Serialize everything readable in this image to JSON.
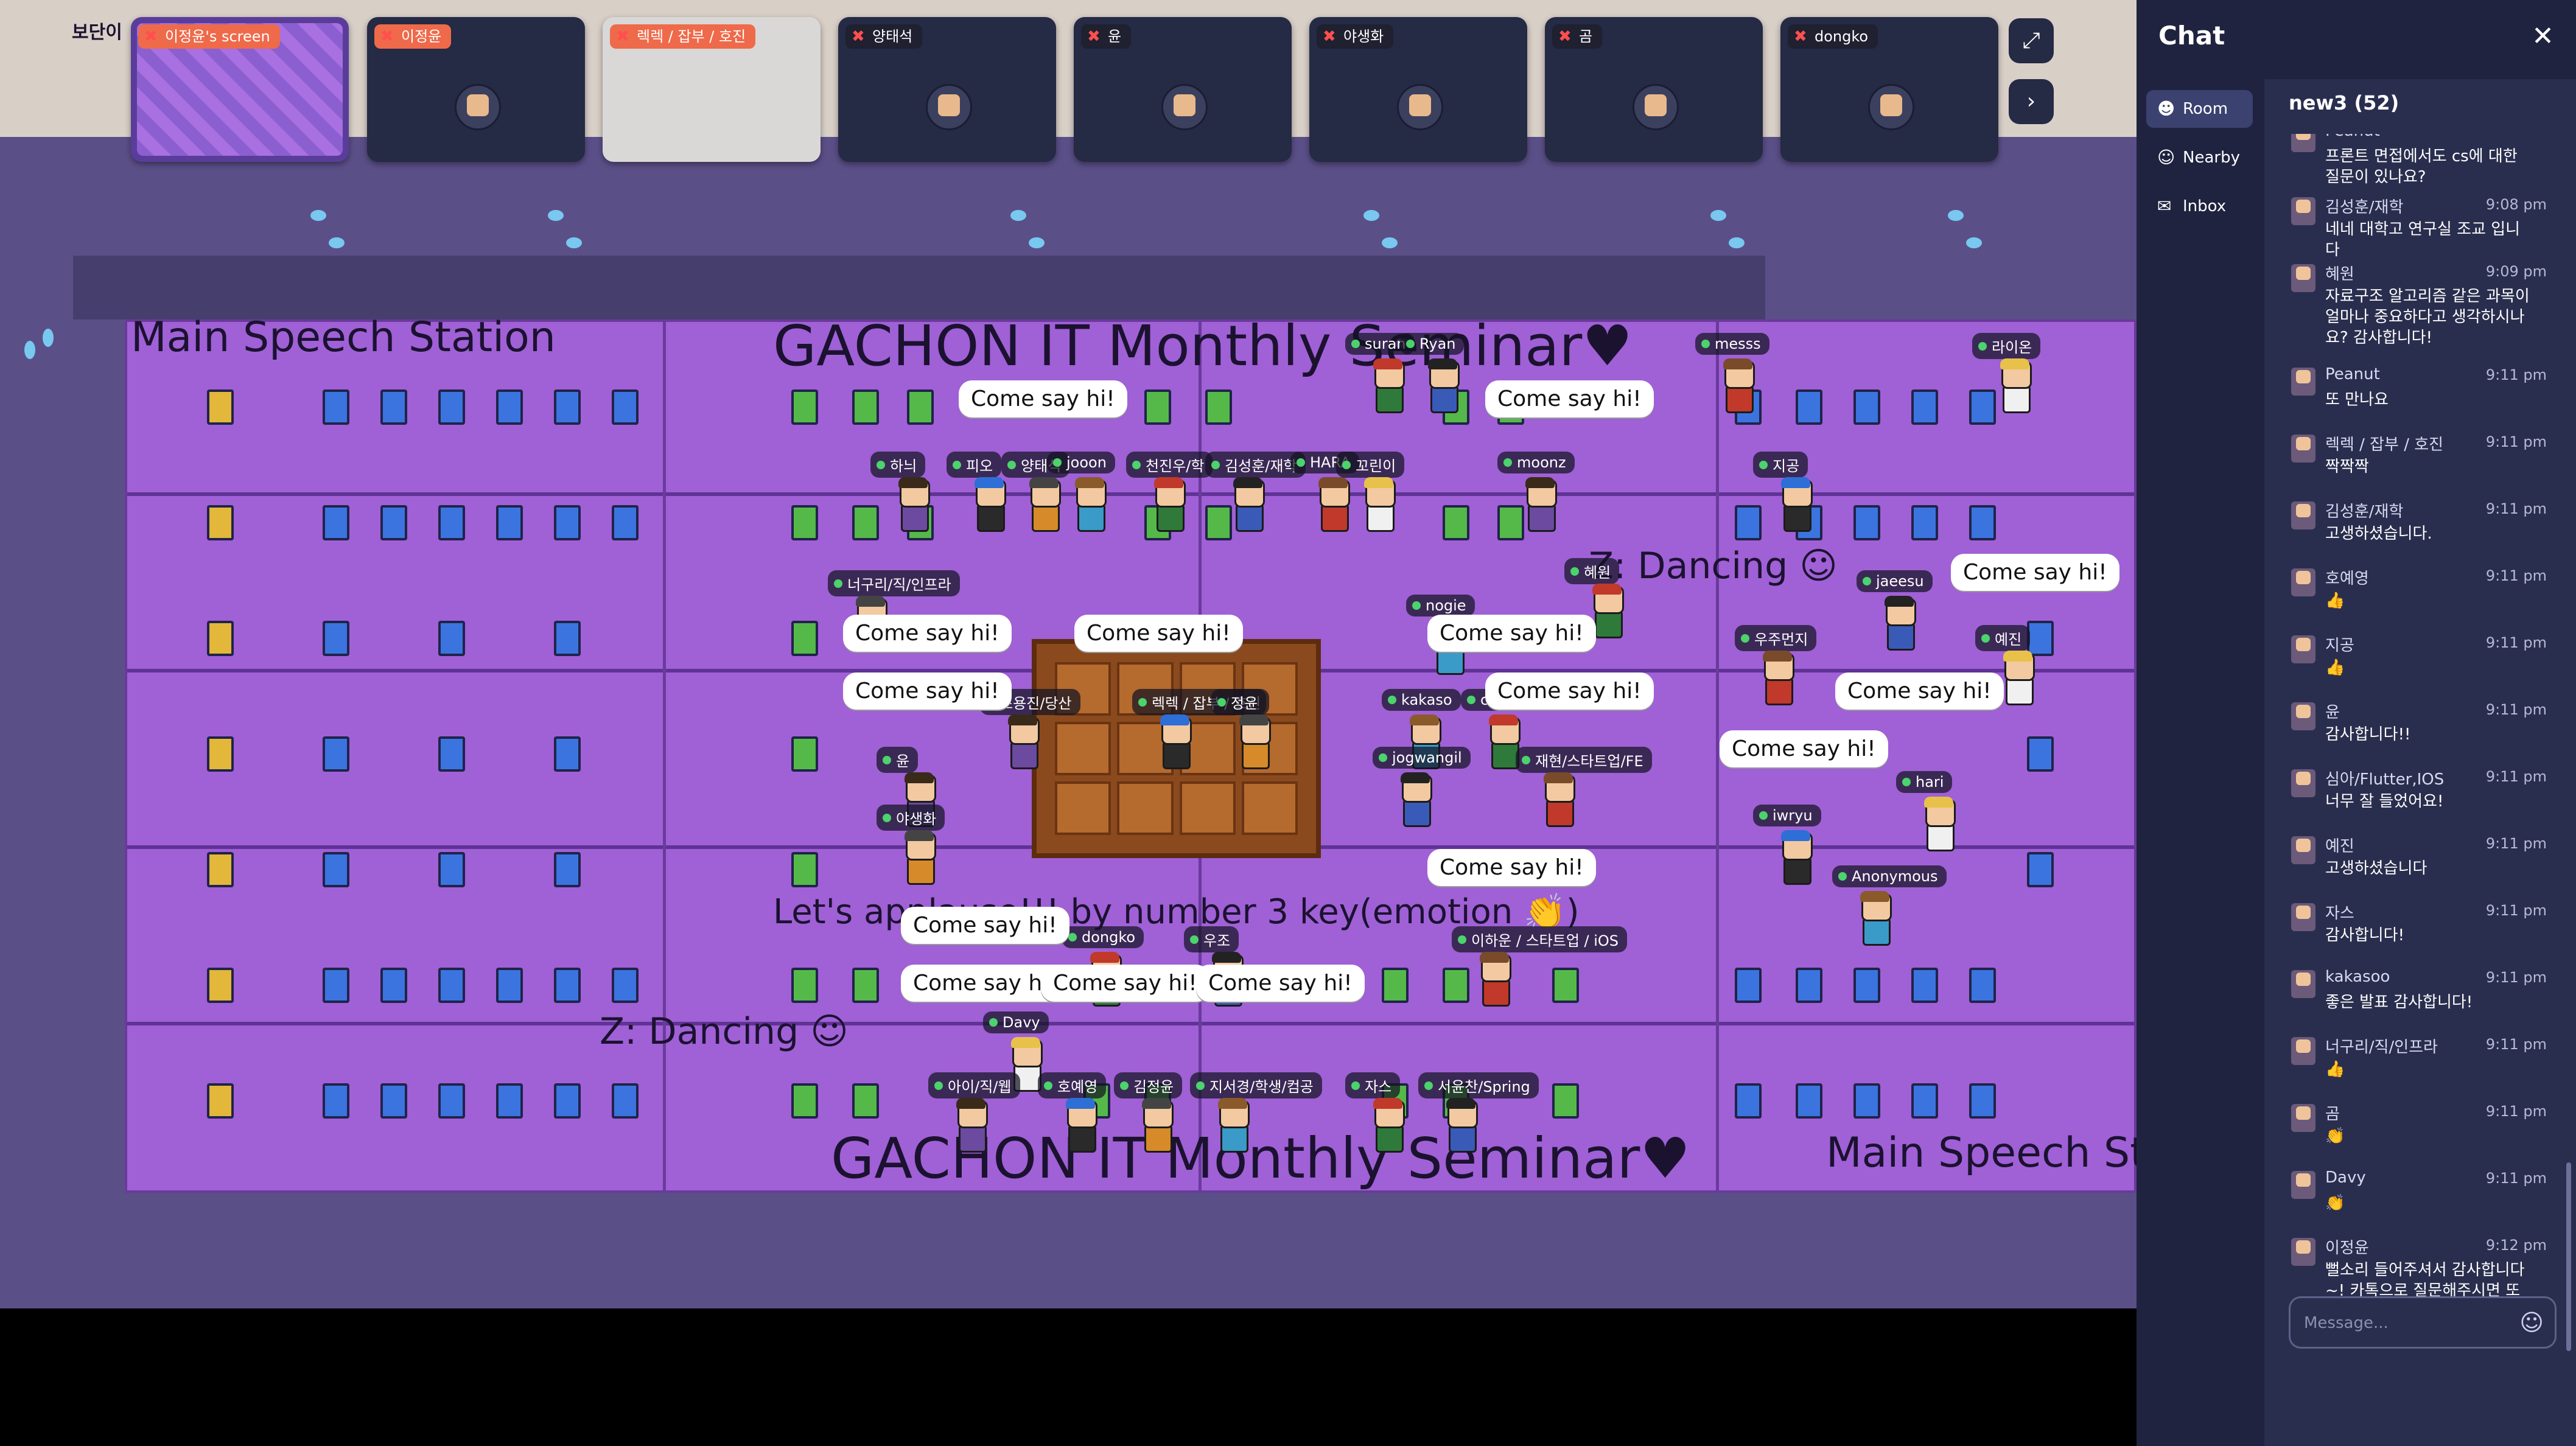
{
  "strip": {
    "tiles": [
      {
        "label": "이정윤's screen",
        "kind": "screen"
      },
      {
        "label": "이정윤",
        "kind": "cam"
      },
      {
        "label": "렉렉 / 잡부 / 호진",
        "kind": "whiteboard"
      },
      {
        "label": "양태석",
        "kind": "cam"
      },
      {
        "label": "윤",
        "kind": "cam"
      },
      {
        "label": "야생화",
        "kind": "cam"
      },
      {
        "label": "곰",
        "kind": "cam"
      },
      {
        "label": "dongko",
        "kind": "cam"
      }
    ],
    "expand_icon": "⤢",
    "next_icon": "›"
  },
  "map": {
    "wall_sign": "보단이",
    "texts": {
      "station_top_left": "Main Speech Station",
      "seminar_top": "GACHON IT Monthly Seminar♥",
      "dancing_right": "Z: Dancing ☺",
      "applause": "Let's applause!!! by number 3 key(emotion 👏)",
      "dancing_left": "Z: Dancing ☺",
      "seminar_bottom": "GACHON IT Monthly Seminar♥",
      "station_bottom_right": "Main Speech St"
    },
    "bubble_text": "Come say hi!",
    "nametags": [
      "suran",
      "Ryan",
      "messs",
      "라이온",
      "하늬",
      "피오",
      "양태석",
      "jooon",
      "천진우/학",
      "김성훈/재학",
      "HARA",
      "꼬린이",
      "moonz",
      "지공",
      "너구리/직/인프라",
      "nogie",
      "혜원",
      "jaeesu",
      "우주먼지",
      "예진",
      "조용진/당산",
      "렉렉 / 잡부 / 호진",
      "정윤",
      "kakaso",
      "cmilk",
      "jogwangil",
      "재현/스타트업/FE",
      "hari",
      "윤",
      "iwryu",
      "야생화",
      "Anonymous",
      "dongko",
      "우조",
      "이하운 / 스타트업 / iOS",
      "Davy",
      "아이/직/웹",
      "호예영",
      "김정윤",
      "지서경/학생/컴공",
      "자스",
      "서윤찬/Spring"
    ]
  },
  "chat": {
    "title": "Chat",
    "close_icon": "✕",
    "tabs": [
      {
        "label": "Room",
        "icon": "☻"
      },
      {
        "label": "Nearby",
        "icon": "☺"
      },
      {
        "label": "Inbox",
        "icon": "✉"
      }
    ],
    "room_name": "new3 (52)",
    "messages": [
      {
        "name": "Peanut",
        "time": "",
        "text": "프론트 면접에서도 cs에 대한 질문이 있나요?"
      },
      {
        "name": "김성훈/재학",
        "time": "9:08 pm",
        "text": "네네 대학고 연구실 조교 입니다"
      },
      {
        "name": "혜원",
        "time": "9:09 pm",
        "text": "자료구조 알고리즘 같은 과목이 얼마나 중요하다고 생각하시나요? 감사합니다!"
      },
      {
        "name": "Peanut",
        "time": "9:11 pm",
        "text": "또 만나요"
      },
      {
        "name": "렉렉 / 잡부 / 호진",
        "time": "9:11 pm",
        "text": "짝짝짝"
      },
      {
        "name": "김성훈/재학",
        "time": "9:11 pm",
        "text": "고생하셨습니다."
      },
      {
        "name": "호예영",
        "time": "9:11 pm",
        "text": "👍"
      },
      {
        "name": "지공",
        "time": "9:11 pm",
        "text": "👍"
      },
      {
        "name": "윤",
        "time": "9:11 pm",
        "text": "감사합니다!!"
      },
      {
        "name": "심아/Flutter,IOS",
        "time": "9:11 pm",
        "text": "너무 잘 들었어요!"
      },
      {
        "name": "예진",
        "time": "9:11 pm",
        "text": "고생하셨습니다"
      },
      {
        "name": "자스",
        "time": "9:11 pm",
        "text": "감사합니다!"
      },
      {
        "name": "kakasoo",
        "time": "9:11 pm",
        "text": "좋은 발표 감사합니다!"
      },
      {
        "name": "너구리/직/인프라",
        "time": "9:11 pm",
        "text": "👍"
      },
      {
        "name": "곰",
        "time": "9:11 pm",
        "text": "👏"
      },
      {
        "name": "Davy",
        "time": "9:11 pm",
        "text": "👏"
      },
      {
        "name": "이정윤",
        "time": "9:12 pm",
        "text": "뻘소리 들어주셔서 감사합니다~! 카톡으로 질문해주시면 또 답변해보겠습니다"
      }
    ],
    "input_placeholder": "Message...",
    "emoji_icon": "☺"
  }
}
